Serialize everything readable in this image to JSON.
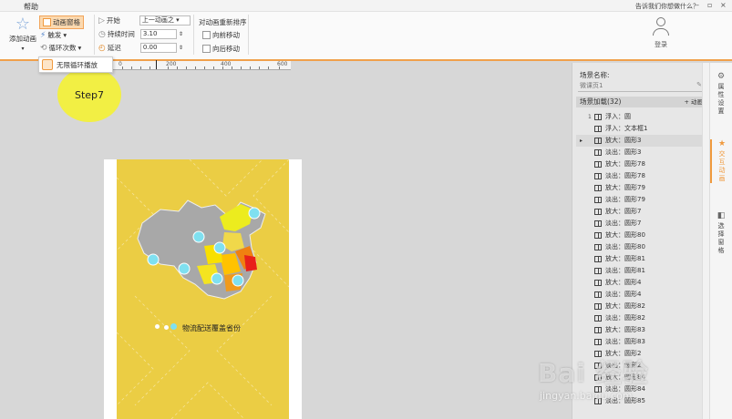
{
  "menubar": {
    "help": "帮助",
    "tell_me": "告诉我们你想做什么？"
  },
  "ribbon": {
    "add_animation": "添加动画",
    "animation_pane": "动画窗格",
    "trigger": "触发",
    "loop_count": "循环次数",
    "start_label": "开始",
    "start_value": "上一动画之",
    "duration_label": "持续时间",
    "duration_value": "3.10",
    "delay_label": "延迟",
    "delay_value": "0.00",
    "reorder_title": "对动画重新排序",
    "move_earlier": "向前移动",
    "move_later": "向后移动",
    "login": "登录"
  },
  "popup": {
    "infinite_loop": "无限循环播放"
  },
  "ruler": {
    "ticks": [
      "0",
      "200",
      "400",
      "600"
    ]
  },
  "step_label": "Step7",
  "canvas": {
    "legend_text": "物流配送覆盖省份"
  },
  "right_panel": {
    "scene_name_label": "场景名称:",
    "scene_name_value": "微课页1",
    "scene_load_label": "场景加载(32)",
    "add_animation": "+ 动画",
    "rows": [
      {
        "num": "1",
        "text": "浮入：圆"
      },
      {
        "num": "",
        "text": "浮入：文本框1"
      },
      {
        "num": "",
        "text": "放大：圆形3",
        "selected": true
      },
      {
        "num": "",
        "text": "淡出：圆形3"
      },
      {
        "num": "",
        "text": "放大：圆形78"
      },
      {
        "num": "",
        "text": "淡出：圆形78"
      },
      {
        "num": "",
        "text": "放大：圆形79"
      },
      {
        "num": "",
        "text": "淡出：圆形79"
      },
      {
        "num": "",
        "text": "放大：圆形7"
      },
      {
        "num": "",
        "text": "淡出：圆形7"
      },
      {
        "num": "",
        "text": "放大：圆形80"
      },
      {
        "num": "",
        "text": "淡出：圆形80"
      },
      {
        "num": "",
        "text": "放大：圆形81"
      },
      {
        "num": "",
        "text": "淡出：圆形81"
      },
      {
        "num": "",
        "text": "放大：圆形4"
      },
      {
        "num": "",
        "text": "淡出：圆形4"
      },
      {
        "num": "",
        "text": "放大：圆形82"
      },
      {
        "num": "",
        "text": "淡出：圆形82"
      },
      {
        "num": "",
        "text": "放大：圆形83"
      },
      {
        "num": "",
        "text": "淡出：圆形83"
      },
      {
        "num": "",
        "text": "放大：圆形2"
      },
      {
        "num": "",
        "text": "淡出：圆形2"
      },
      {
        "num": "",
        "text": "放大：圆形84"
      },
      {
        "num": "",
        "text": "淡出：圆形84"
      },
      {
        "num": "",
        "text": "淡出：圆形85"
      }
    ]
  },
  "side_tabs": {
    "properties": "属性设置",
    "interactive_animation": "交互动画",
    "select_pane": "选择窗格"
  },
  "watermark": {
    "big": "Bai 经验",
    "small": "jingyan.baidu.com"
  },
  "colors": {
    "accent": "#f09a3e",
    "page_bg": "#ebcd44",
    "highlight": "#f2ef44"
  }
}
